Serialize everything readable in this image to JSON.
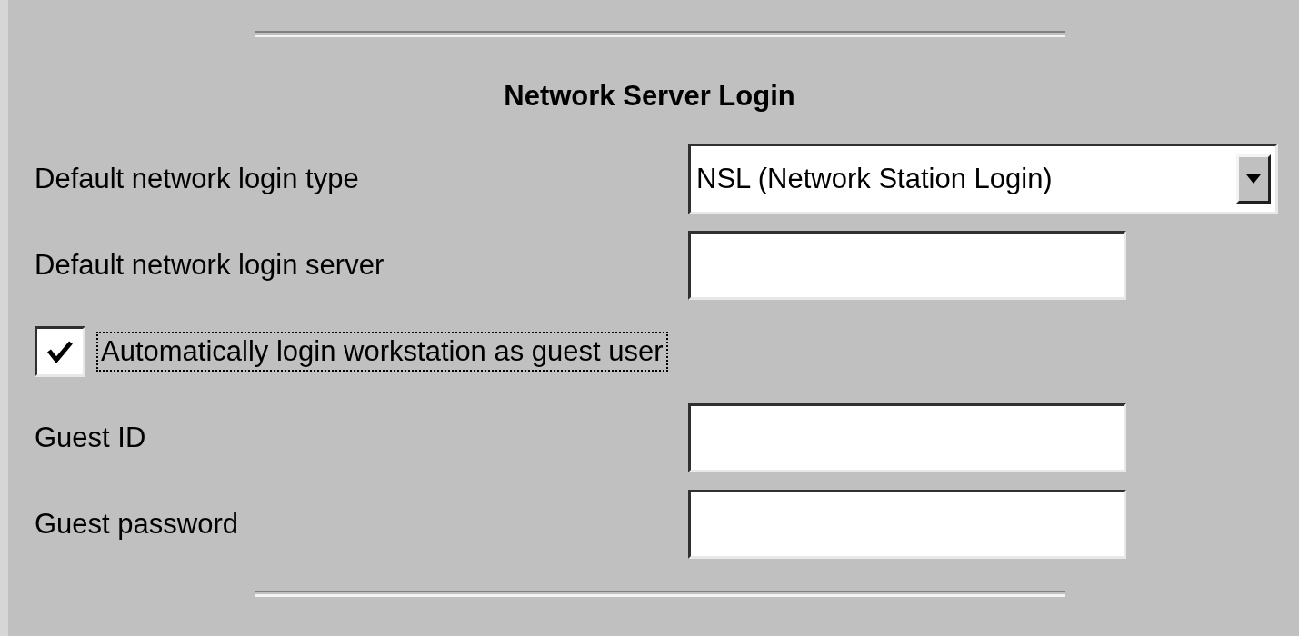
{
  "title": "Network Server Login",
  "fields": [
    {
      "kind": "dropdown",
      "label": "Default network login type",
      "value": "NSL (Network Station Login)"
    },
    {
      "kind": "text",
      "label": "Default network login server"
    },
    {
      "kind": "checkbox",
      "label": "Automatically login workstation as guest user",
      "checked": true
    },
    {
      "kind": "text",
      "label": "Guest ID"
    },
    {
      "kind": "text",
      "label": "Guest password"
    }
  ]
}
